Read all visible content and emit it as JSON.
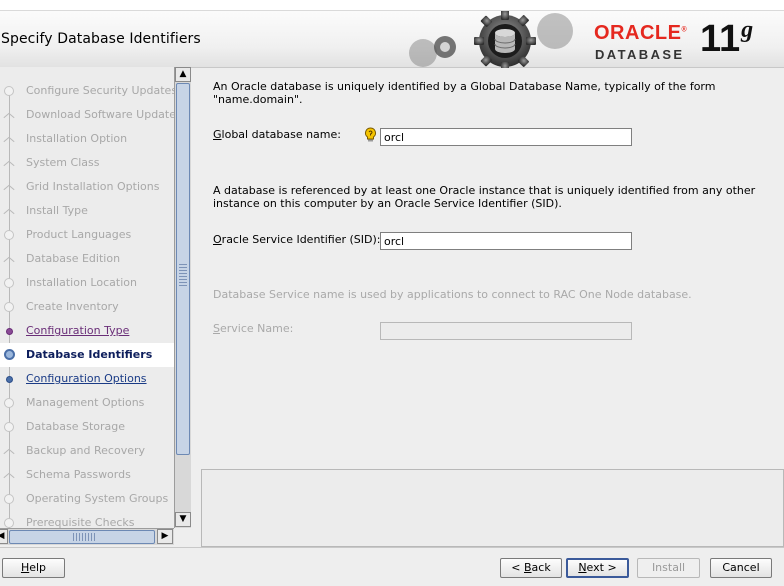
{
  "header": {
    "title": "Specify Database Identifiers",
    "logo": {
      "oracle": "ORACLE",
      "database": "DATABASE",
      "version": "11",
      "version_suffix": "g"
    }
  },
  "steps": [
    {
      "label": "Configure Security Updates",
      "state": "disabled",
      "marker": "dot"
    },
    {
      "label": "Download Software Updates",
      "state": "disabled",
      "marker": "branch"
    },
    {
      "label": "Installation Option",
      "state": "disabled",
      "marker": "branch"
    },
    {
      "label": "System Class",
      "state": "disabled",
      "marker": "branch"
    },
    {
      "label": "Grid Installation Options",
      "state": "disabled",
      "marker": "branch"
    },
    {
      "label": "Install Type",
      "state": "disabled",
      "marker": "branch"
    },
    {
      "label": "Product Languages",
      "state": "disabled",
      "marker": "dot"
    },
    {
      "label": "Database Edition",
      "state": "disabled",
      "marker": "branch"
    },
    {
      "label": "Installation Location",
      "state": "disabled",
      "marker": "dot"
    },
    {
      "label": "Create Inventory",
      "state": "disabled",
      "marker": "dot"
    },
    {
      "label": "Configuration Type",
      "state": "visited",
      "marker": "dot"
    },
    {
      "label": "Database Identifiers",
      "state": "current",
      "marker": "dot"
    },
    {
      "label": "Configuration Options",
      "state": "next",
      "marker": "dot"
    },
    {
      "label": "Management Options",
      "state": "disabled",
      "marker": "dot"
    },
    {
      "label": "Database Storage",
      "state": "disabled",
      "marker": "dot"
    },
    {
      "label": "Backup and Recovery",
      "state": "disabled",
      "marker": "branch"
    },
    {
      "label": "Schema Passwords",
      "state": "disabled",
      "marker": "branch"
    },
    {
      "label": "Operating System Groups",
      "state": "disabled",
      "marker": "dot"
    },
    {
      "label": "Prerequisite Checks",
      "state": "disabled",
      "marker": "dot"
    }
  ],
  "main": {
    "intro_line1": "An Oracle database is uniquely identified by a Global Database Name, typically of the form",
    "intro_line2": "\"name.domain\".",
    "global_name_label": "Global database name:",
    "global_name_value": "orcl",
    "sid_desc_line1": "A database is referenced by at least one Oracle instance that is uniquely identified from any other",
    "sid_desc_line2": "instance on this computer by an Oracle Service Identifier (SID).",
    "sid_label": "Oracle Service Identifier (SID):",
    "sid_value": "orcl",
    "service_desc": "Database Service name is used by applications to connect to RAC One Node database.",
    "service_label": "Service Name:",
    "service_value": ""
  },
  "footer": {
    "help": "Help",
    "back": "< Back",
    "next": "Next >",
    "install": "Install",
    "cancel": "Cancel"
  },
  "colors": {
    "oracle_red": "#e5281f",
    "visited_link": "#6a2e78",
    "next_link": "#1a3b86",
    "current_text": "#0d1e5c"
  }
}
